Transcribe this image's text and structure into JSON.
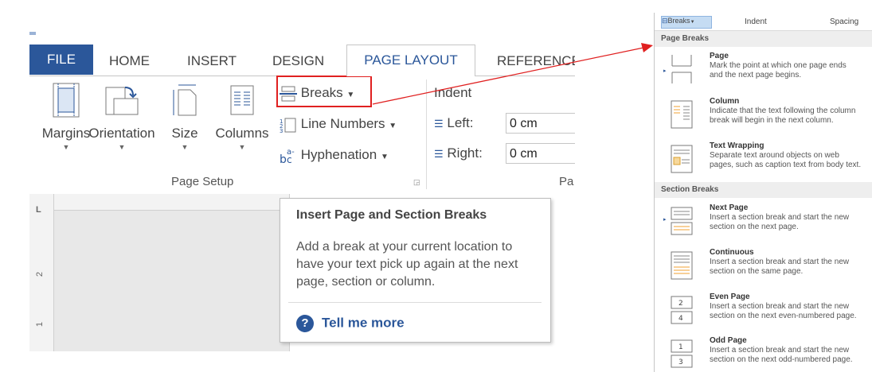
{
  "ribbon": {
    "tabs": [
      "FILE",
      "HOME",
      "INSERT",
      "DESIGN",
      "PAGE LAYOUT",
      "REFERENCE"
    ],
    "page_setup": {
      "margins": "Margins",
      "orientation": "Orientation",
      "size": "Size",
      "columns": "Columns",
      "breaks": "Breaks",
      "line_numbers": "Line Numbers",
      "hyphenation": "Hyphenation",
      "group_label": "Page Setup"
    },
    "indent": {
      "label": "Indent",
      "left_label": "Left:",
      "left_value": "0 cm",
      "right_label": "Right:",
      "right_value": "0 cm",
      "group_label_partial": "Pa"
    },
    "ruler_corner": "L",
    "ruler_numbers": [
      "2",
      "1"
    ]
  },
  "tooltip": {
    "title": "Insert Page and Section Breaks",
    "body": "Add a break at your current location to have your text pick up again at the next page, section or column.",
    "help_link": "Tell me more",
    "help_icon": "?"
  },
  "menu": {
    "top": {
      "breaks": "Breaks",
      "indent": "Indent",
      "spacing": "Spacing"
    },
    "page_breaks_header": "Page Breaks",
    "section_breaks_header": "Section Breaks",
    "items": [
      {
        "title": "Page",
        "desc1": "Mark the point at which one page ends",
        "desc2": "and the next page begins."
      },
      {
        "title": "Column",
        "desc1": "Indicate that the text following the column",
        "desc2": "break will begin in the next column."
      },
      {
        "title": "Text Wrapping",
        "desc1": "Separate text around objects on web",
        "desc2": "pages, such as caption text from body text."
      },
      {
        "title": "Next Page",
        "desc1": "Insert a section break and start the new",
        "desc2": "section on the next page."
      },
      {
        "title": "Continuous",
        "desc1": "Insert a section break and start the new",
        "desc2": "section on the same page."
      },
      {
        "title": "Even Page",
        "desc1": "Insert a section break and start the new",
        "desc2": "section on the next even-numbered page."
      },
      {
        "title": "Odd Page",
        "desc1": "Insert a section break and start the new",
        "desc2": "section on the next odd-numbered page."
      }
    ]
  },
  "colors": {
    "accent": "#2b579a",
    "highlight_box": "#e02020",
    "arrow": "#e02020"
  }
}
